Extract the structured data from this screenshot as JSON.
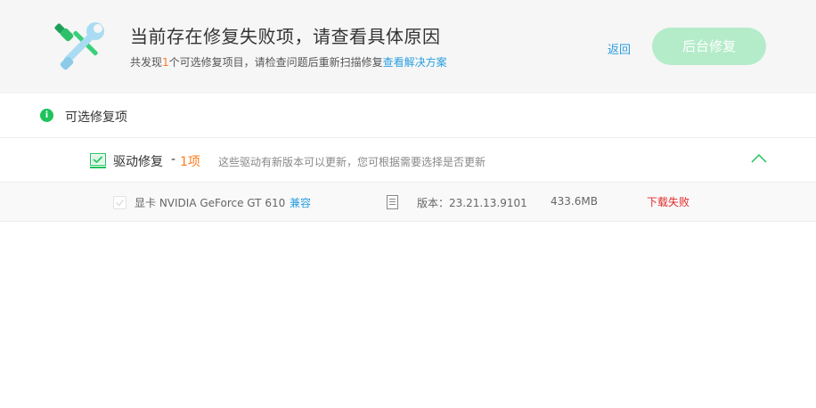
{
  "header": {
    "title": "当前存在修复失败项，请查看具体原因",
    "sub_prefix": "共发现",
    "sub_count": "1",
    "sub_middle": "个可选修复项目，请检查问题后重新扫描修复",
    "sub_link": "查看解决方案",
    "back_label": "返回",
    "bg_repair_label": "后台修复"
  },
  "section": {
    "info_glyph": "i",
    "title": "可选修复项"
  },
  "group": {
    "name": "驱动修复",
    "dash": "-",
    "count": "1项",
    "description": "这些驱动有新版本可以更新，您可根据需要选择是否更新"
  },
  "driver": {
    "name": "显卡 NVIDIA GeForce GT 610",
    "compat": "兼容",
    "version": "版本：23.21.13.9101",
    "size": "433.6MB",
    "status": "下载失败"
  },
  "colors": {
    "accent_green": "#1ec35b",
    "button_disabled_green": "#b4ecc9",
    "link_blue": "#2a9ee0",
    "count_orange": "#ff7a1a",
    "error_red": "#e02a2a"
  },
  "icons": {
    "header": "repair-tools-icon",
    "info": "info-icon",
    "group": "driver-monitor-icon",
    "collapse": "chevron-up-icon",
    "details": "document-icon",
    "checkbox": "checkmark-icon"
  }
}
